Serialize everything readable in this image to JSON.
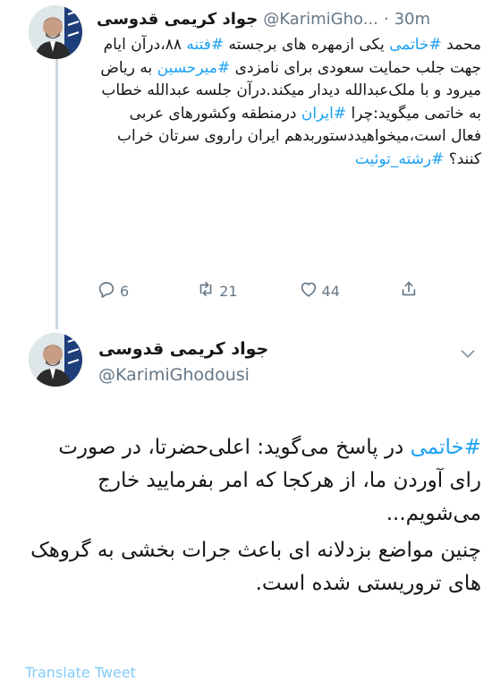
{
  "tweet1": {
    "display_name": "جواد کریمی قدوسی",
    "handle": "@KarimiGho...",
    "separator": "·",
    "time": "30m",
    "body_parts": [
      {
        "text": "محمد ",
        "hashtag": false
      },
      {
        "text": "#خاتمی",
        "hashtag": true
      },
      {
        "text": " یکی ازمهره های برجسته ",
        "hashtag": false
      },
      {
        "text": "#فتنه",
        "hashtag": true
      },
      {
        "text": " ۸۸،درآن ایام جهت جلب حمایت سعودی برای نامزدی ",
        "hashtag": false
      },
      {
        "text": "#میرحسین",
        "hashtag": true
      },
      {
        "text": " به ریاض میرود و با ملک‌عبدالله دیدار میکند.درآن جلسه عبدالله خطاب به خاتمی میگوید:چرا ",
        "hashtag": false
      },
      {
        "text": "#ایران",
        "hashtag": true
      },
      {
        "text": " درمنطقه وکشورهای عربی فعال است،میخواهیددستوربدهم ایران راروی سرتان خراب کنند؟ ",
        "hashtag": false
      },
      {
        "text": "#رشته_توئیت",
        "hashtag": true
      }
    ],
    "reply_count": "6",
    "retweet_count": "21",
    "like_count": "44"
  },
  "tweet2": {
    "display_name": "جواد کریمی قدوسی",
    "handle": "@KarimiGhodousi",
    "hashtag": "#خاتمی",
    "paragraph1_rest": " در پاسخ می‌گوید: اعلی‌حضرتا، در صورت رای آوردن ما، از هرکجا که امر بفرمایید خارج می‌شویم...",
    "paragraph2": "چنین مواضع بزدلانه ای باعث جرات بخشی به گروهک های تروریستی شده است.",
    "translate_link": "Translate Tweet"
  },
  "colors": {
    "accent": "#1da1f2",
    "muted": "#657786",
    "text": "#14171a",
    "thread_line": "#ccd6dd"
  },
  "icons": [
    "reply-icon",
    "retweet-icon",
    "like-icon",
    "share-icon",
    "chevron-down-icon"
  ]
}
